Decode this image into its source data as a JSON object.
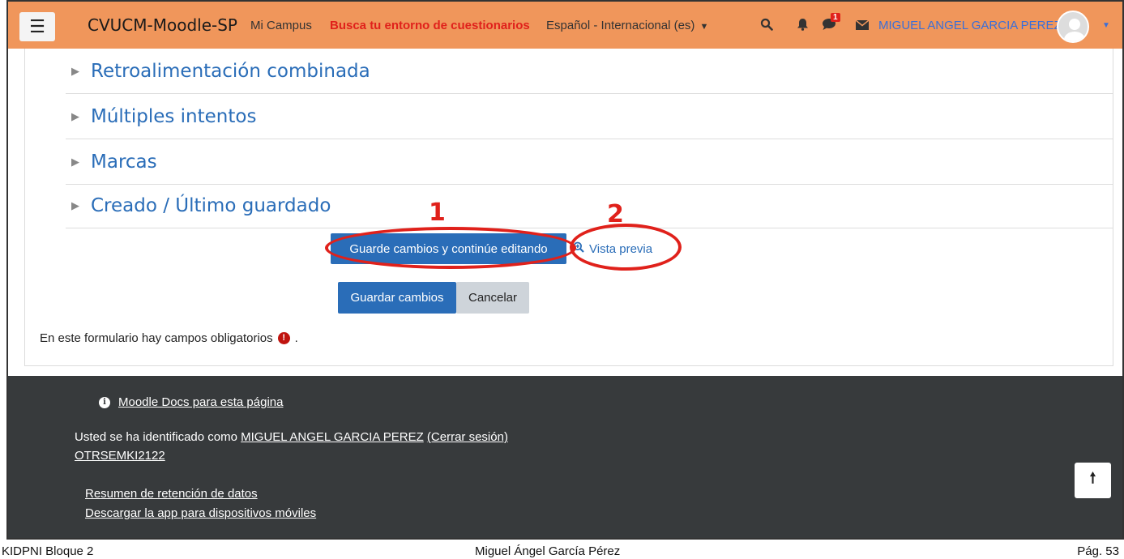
{
  "navbar": {
    "menu_icon": "hamburger-icon",
    "brand": "CVUCM-Moodle-SP",
    "mi_campus": "Mi Campus",
    "busca": "Busca tu entorno de cuestionarios",
    "language": "Español - Internacional (es)",
    "notification_badge": "1",
    "username": "MIGUEL ANGEL GARCIA PEREZ",
    "colors": {
      "bar": "#f0965b",
      "highlight": "#e0211b",
      "user": "#3a6fd8"
    }
  },
  "sections": [
    {
      "label": "Retroalimentación combinada"
    },
    {
      "label": "Múltiples intentos"
    },
    {
      "label": "Marcas"
    },
    {
      "label": "Creado / Último guardado"
    }
  ],
  "buttons": {
    "save_continue": "Guarde cambios y continúe editando",
    "preview": "Vista previa",
    "save": "Guardar cambios",
    "cancel": "Cancelar"
  },
  "annotations": {
    "one": "1",
    "two": "2"
  },
  "required_note": "En este formulario hay campos obligatorios",
  "required_suffix": ".",
  "footer": {
    "docs": "Moodle Docs para esta página",
    "identified_prefix": "Usted se ha identificado como",
    "identified_user": "MIGUEL ANGEL GARCIA PEREZ",
    "logout": "(Cerrar sesión)",
    "course": "OTRSEMKI2122",
    "retention": "Resumen de retención de datos",
    "app": "Descargar la app para dispositivos móviles"
  },
  "page_footer": {
    "left": "KIDPNI Bloque 2",
    "center": "Miguel Ángel García Pérez",
    "right": "Pág. 53"
  }
}
